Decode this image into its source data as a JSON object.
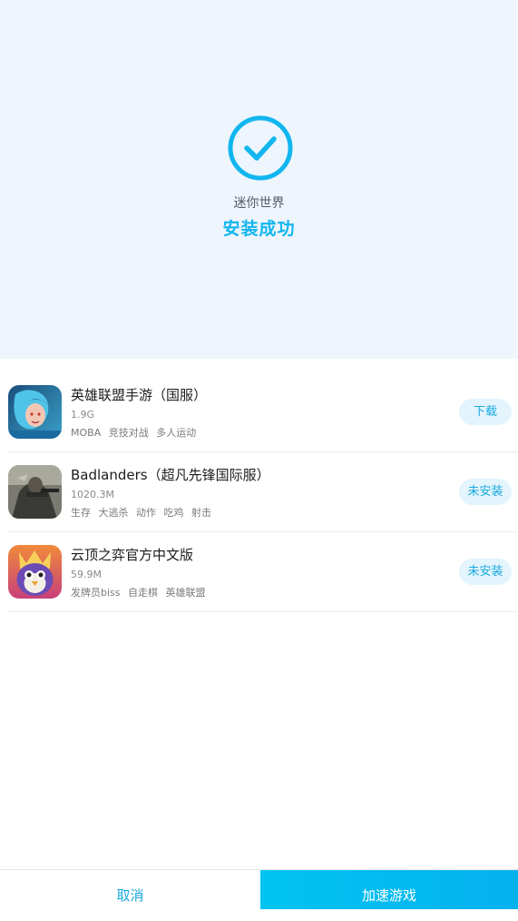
{
  "install_result": {
    "app_name": "迷你世界",
    "status_text": "安装成功",
    "accent_color": "#12b6ef",
    "icon": "check-circle-icon"
  },
  "games": [
    {
      "title": "英雄联盟手游（国服）",
      "size": "1.9G",
      "tags": [
        "MOBA",
        "竞技对战",
        "多人运动"
      ],
      "action_label": "下载",
      "icon": "league-of-legends-thumbnail"
    },
    {
      "title": "Badlanders（超凡先锋国际服）",
      "size": "1020.3M",
      "tags": [
        "生存",
        "大逃杀",
        "动作",
        "吃鸡",
        "射击"
      ],
      "action_label": "未安装",
      "icon": "badlanders-thumbnail"
    },
    {
      "title": "云顶之弈官方中文版",
      "size": "59.9M",
      "tags": [
        "发牌员biss",
        "自走棋",
        "英雄联盟"
      ],
      "action_label": "未安装",
      "icon": "teamfight-tactics-thumbnail"
    }
  ],
  "footer": {
    "cancel_label": "取消",
    "accelerate_label": "加速游戏"
  }
}
